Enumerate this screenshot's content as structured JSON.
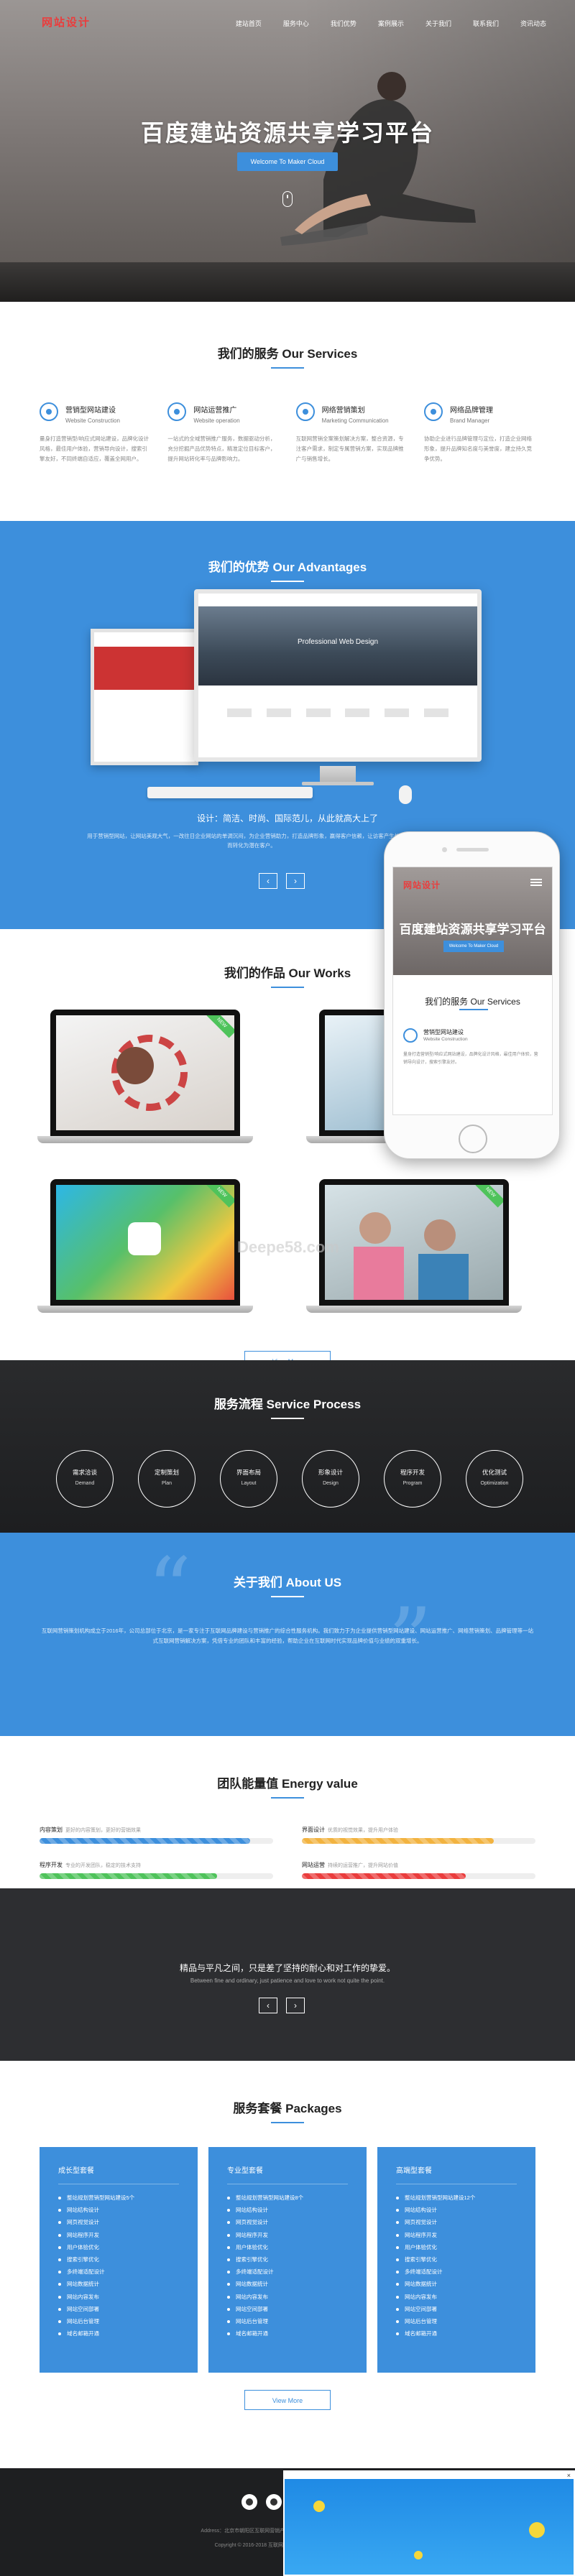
{
  "brand": {
    "logo": "网站设计",
    "accent": "#3d8fdc",
    "logo_color": "#ea3d3d"
  },
  "nav": {
    "items": [
      "建站首页",
      "服务中心",
      "我们优势",
      "案例展示",
      "关于我们",
      "联系我们",
      "资讯动态"
    ]
  },
  "hero": {
    "title": "百度建站资源共享学习平台",
    "button": "Welcome To Maker Cloud"
  },
  "services": {
    "title": "我们的服务 Our Services",
    "items": [
      {
        "name": "营销型网站建设",
        "en": "Website Construction",
        "icon": "globe-icon",
        "desc": "量身打造营销型/响应式网站建设，品牌化设计风格，最佳用户体验，营销导向设计，搜索引擎友好，不同终端自适应，覆盖全网用户。"
      },
      {
        "name": "网站运营推广",
        "en": "Website operation",
        "icon": "chart-icon",
        "desc": "一站式的全域营销推广服务，数据驱动分析，充分挖掘产品优势特点，精准定位目标客户，提升网站转化率与品牌影响力。"
      },
      {
        "name": "网络营销策划",
        "en": "Marketing Communication",
        "icon": "compass-icon",
        "desc": "互联网营销全案策划解决方案，整合资源，专注客户需求，制定专属营销方案，实现品牌推广与销售增长。"
      },
      {
        "name": "网络品牌管理",
        "en": "Brand Manager",
        "icon": "refresh-icon",
        "desc": "协助企业进行品牌管理与定位，打造企业网络形象，提升品牌知名度与美誉度，建立持久竞争优势。"
      }
    ]
  },
  "advantages": {
    "title": "我们的优势 Our Advantages",
    "tagline": "设计：简洁、时尚、国际范儿，从此就高大上了",
    "desc": "用于营销型网站，让网站美观大气，一改往日企业网站的单调沉闷，为企业营销助力，打造品牌形象，赢得客户信赖，让访客产生信任，从而转化为潜在客户。",
    "monitor_banner": "Professional Web Design"
  },
  "phone": {
    "logo": "网站设计",
    "title": "百度建站资源共享学习平台",
    "button": "Welcome To Maker Cloud",
    "section": "我们的服务 Our Services",
    "service": "营销型网站建设",
    "service_en": "Website Construction",
    "service_desc": "量身打造营销型/响应式网站建设，品牌化设计风格，最佳用户体验，营销导向设计，搜索引擎友好。"
  },
  "works": {
    "title": "我们的作品 Our Works",
    "more": "View More",
    "ribbon": "NEW",
    "watermark": "Deepe58.com"
  },
  "process": {
    "title": "服务流程 Service Process",
    "steps": [
      {
        "cn": "需求洽谈",
        "en": "Demand"
      },
      {
        "cn": "定制策划",
        "en": "Plan"
      },
      {
        "cn": "界面布局",
        "en": "Layout"
      },
      {
        "cn": "形象设计",
        "en": "Design"
      },
      {
        "cn": "程序开发",
        "en": "Program"
      },
      {
        "cn": "优化测试",
        "en": "Optimization"
      }
    ]
  },
  "about": {
    "title": "关于我们 About US",
    "text": "互联网营销策划机构成立于2016年，公司总部位于北京，是一家专注于互联网品牌建设与营销推广的综合性服务机构。我们致力于为企业提供营销型网站建设、网站运营推广、网络营销策划、品牌管理等一站式互联网营销解决方案，凭借专业的团队和丰富的经验，帮助企业在互联网时代实现品牌价值与业绩的双重增长。"
  },
  "energy": {
    "title": "团队能量值 Energy value",
    "bars": [
      {
        "label": "内容策划",
        "note": "更好的内容策划，更好的营销效果",
        "value": 0.9,
        "color": "#3d8fdc"
      },
      {
        "label": "界面设计",
        "note": "优质的视觉效果，提升用户体验",
        "value": 0.82,
        "color": "#f2b340"
      },
      {
        "label": "程序开发",
        "note": "专业的开发团队，稳定的技术支持",
        "value": 0.76,
        "color": "#4fc35b"
      },
      {
        "label": "网站运营",
        "note": "持续的运营推广，提升网站价值",
        "value": 0.7,
        "color": "#ea3d3d"
      }
    ]
  },
  "quote": {
    "cn": "精品与平凡之间，只是差了坚持的耐心和对工作的挚爱。",
    "en": "Between fine and ordinary, just patience and love to work not quite the point."
  },
  "packages": {
    "title": "服务套餐 Packages",
    "more": "View More",
    "items": [
      {
        "name": "成长型套餐",
        "features": [
          "整站规划营销型网站建设5个",
          "网站结构设计",
          "网页视觉设计",
          "网站程序开发",
          "用户体验优化",
          "搜索引擎优化",
          "多终端适配设计",
          "网站数据统计",
          "网站内容发布",
          "网站空间部署",
          "网站后台管理",
          "域名邮箱开通"
        ]
      },
      {
        "name": "专业型套餐",
        "features": [
          "整站规划营销型网站建设8个",
          "网站结构设计",
          "网页视觉设计",
          "网站程序开发",
          "用户体验优化",
          "搜索引擎优化",
          "多终端适配设计",
          "网站数据统计",
          "网站内容发布",
          "网站空间部署",
          "网站后台管理",
          "域名邮箱开通"
        ]
      },
      {
        "name": "高端型套餐",
        "features": [
          "整站规划营销型网站建设12个",
          "网站结构设计",
          "网页视觉设计",
          "网站程序开发",
          "用户体验优化",
          "搜索引擎优化",
          "多终端适配设计",
          "网站数据统计",
          "网站内容发布",
          "网站空间部署",
          "网站后台管理",
          "域名邮箱开通"
        ]
      }
    ]
  },
  "footer": {
    "icons": [
      "qq-icon",
      "wechat-icon"
    ],
    "line1": "Address：北京市朝阳区互联网营销产业园区 | E-mail：service@example.com",
    "line2": "Copyright © 2016-2018 互联网营销策划机构 All Rights Reserved."
  }
}
